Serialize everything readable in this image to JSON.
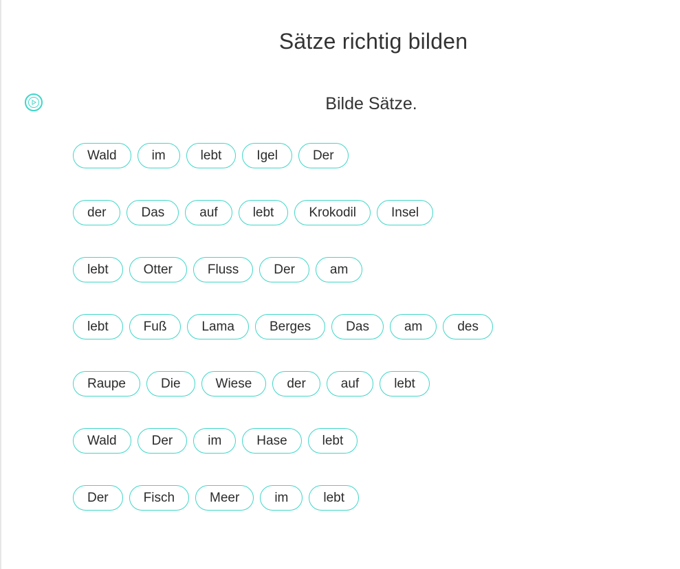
{
  "header": {
    "title": "Sätze richtig bilden"
  },
  "exercise": {
    "instruction": "Bilde Sätze.",
    "audio_icon": "play-circle-icon",
    "accent_color": "#3fd6c8",
    "rows": [
      [
        "Wald",
        "im",
        "lebt",
        "Igel",
        "Der"
      ],
      [
        "der",
        "Das",
        "auf",
        "lebt",
        "Krokodil",
        "Insel"
      ],
      [
        "lebt",
        "Otter",
        "Fluss",
        "Der",
        "am"
      ],
      [
        "lebt",
        "Fuß",
        "Lama",
        "Berges",
        "Das",
        "am",
        "des"
      ],
      [
        "Raupe",
        "Die",
        "Wiese",
        "der",
        "auf",
        "lebt"
      ],
      [
        "Wald",
        "Der",
        "im",
        "Hase",
        "lebt"
      ],
      [
        "Der",
        "Fisch",
        "Meer",
        "im",
        "lebt"
      ]
    ]
  }
}
